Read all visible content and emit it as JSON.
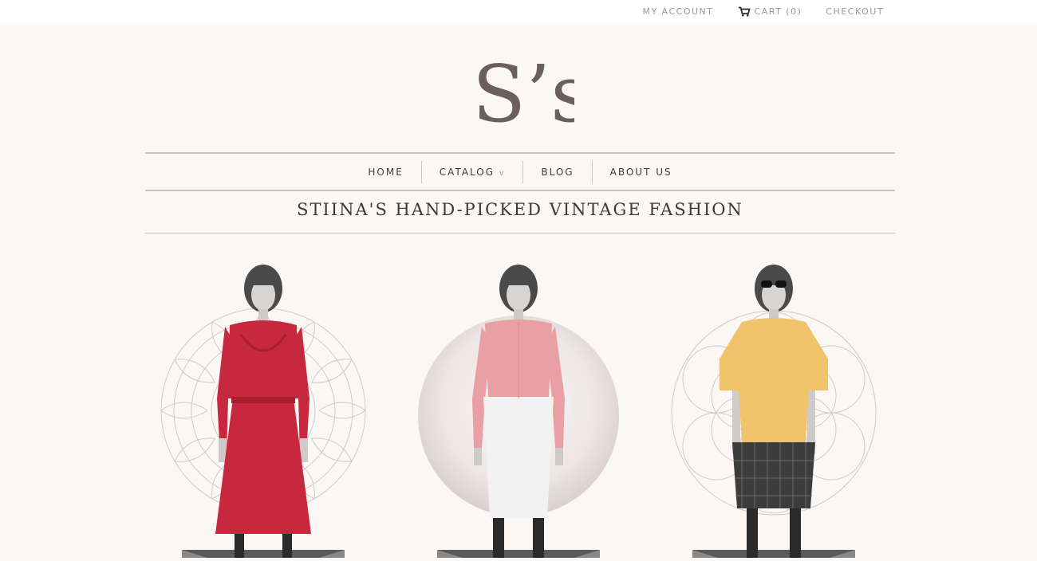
{
  "header": {
    "account_label": "MY ACCOUNT",
    "cart_label": "CART (0)",
    "checkout_label": "CHECKOUT"
  },
  "logo": {
    "text": "S’s",
    "color": "#6b5e60"
  },
  "nav": {
    "items": [
      {
        "label": "HOME"
      },
      {
        "label": "CATALOG",
        "has_dropdown": true,
        "chevron": "v"
      },
      {
        "label": "BLOG"
      },
      {
        "label": "ABOUT US"
      }
    ]
  },
  "headline": "STIINA'S HAND-PICKED VINTAGE FASHION",
  "products": [
    {
      "image": "model-red-dress",
      "backdrop": "mandala-icon",
      "garment_color": "#c7283e"
    },
    {
      "image": "model-pink-blouse-white-skirt",
      "backdrop": "marble-circle",
      "garment_color": "#e8a0a5"
    },
    {
      "image": "model-yellow-sweater-plaid-skirt",
      "backdrop": "flower-of-life-icon",
      "garment_color": "#f0c46a"
    }
  ],
  "colors": {
    "background": "#fbf7f5",
    "rule": "#c9c6c4",
    "text": "#3d3d3d",
    "muted": "#9a9a9a"
  }
}
